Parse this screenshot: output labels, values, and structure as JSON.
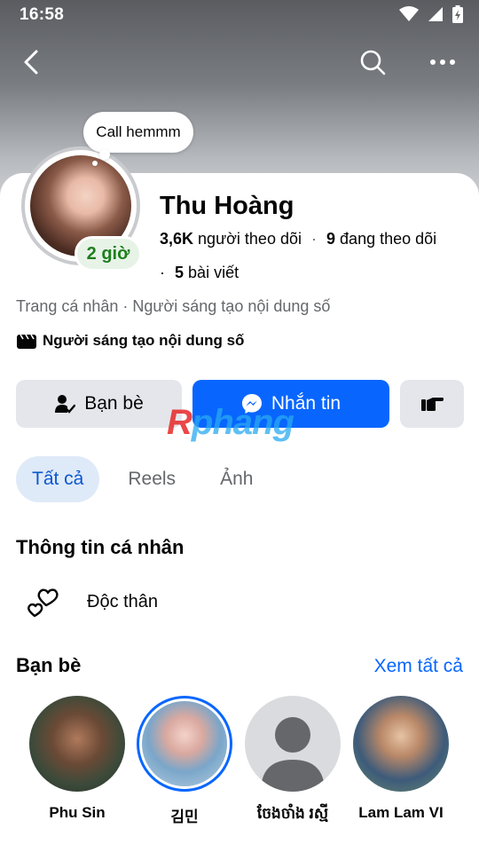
{
  "status_bar": {
    "time": "16:58"
  },
  "note": {
    "text": "Call hemmm"
  },
  "active_status": "2 giờ",
  "profile": {
    "name": "Thu Hoàng",
    "followers_count": "3,6K",
    "followers_label": "người theo dõi",
    "following_count": "9",
    "following_label": "đang theo dõi",
    "posts_count": "5",
    "posts_label": "bài viết",
    "category_line": "Trang cá nhân · Người sáng tạo nội dung số",
    "creator_label": "Người sáng tạo nội dung số"
  },
  "actions": {
    "friends_label": "Bạn bè",
    "message_label": "Nhắn tin"
  },
  "watermark": {
    "r": "R",
    "rest": "phang"
  },
  "tabs": [
    {
      "label": "Tất cả",
      "active": true
    },
    {
      "label": "Reels",
      "active": false
    },
    {
      "label": "Ảnh",
      "active": false
    }
  ],
  "personal_info": {
    "title": "Thông tin cá nhân",
    "relationship": "Độc thân"
  },
  "friends": {
    "title": "Bạn bè",
    "see_all": "Xem tất cả",
    "items": [
      {
        "name": "Phu Sin"
      },
      {
        "name": "김민"
      },
      {
        "name": "ចែងចាំង រស្មី"
      },
      {
        "name": "Lam Lam VI"
      }
    ]
  },
  "colors": {
    "accent": "#0866ff",
    "active_green": "#1e7e1e",
    "tab_active_bg": "#dfeaf8"
  }
}
